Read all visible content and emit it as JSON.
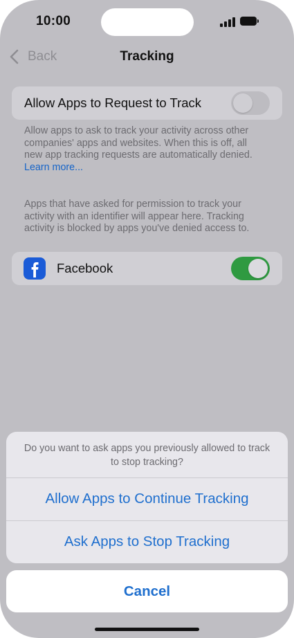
{
  "status_bar": {
    "time": "10:00"
  },
  "nav": {
    "back_label": "Back",
    "title": "Tracking"
  },
  "allow_tracking": {
    "label": "Allow Apps to Request to Track",
    "enabled": false,
    "description": "Allow apps to ask to track your activity across other companies' apps and websites. When this is off, all new app tracking requests are automatically denied.",
    "learn_more": "Learn more..."
  },
  "apps_info": "Apps that have asked for permission to track your activity with an identifier will appear here. Tracking activity is blocked by apps you've denied access to.",
  "apps": [
    {
      "name": "Facebook",
      "icon": "facebook-icon",
      "enabled": true
    }
  ],
  "action_sheet": {
    "message": "Do you want to ask apps you previously allowed to track to stop tracking?",
    "actions": [
      "Allow Apps to Continue Tracking",
      "Ask Apps to Stop Tracking"
    ],
    "cancel": "Cancel"
  },
  "colors": {
    "accent_blue": "#1f6fce",
    "toggle_on_green": "#2f9a41",
    "facebook_blue": "#1a5bd7"
  }
}
